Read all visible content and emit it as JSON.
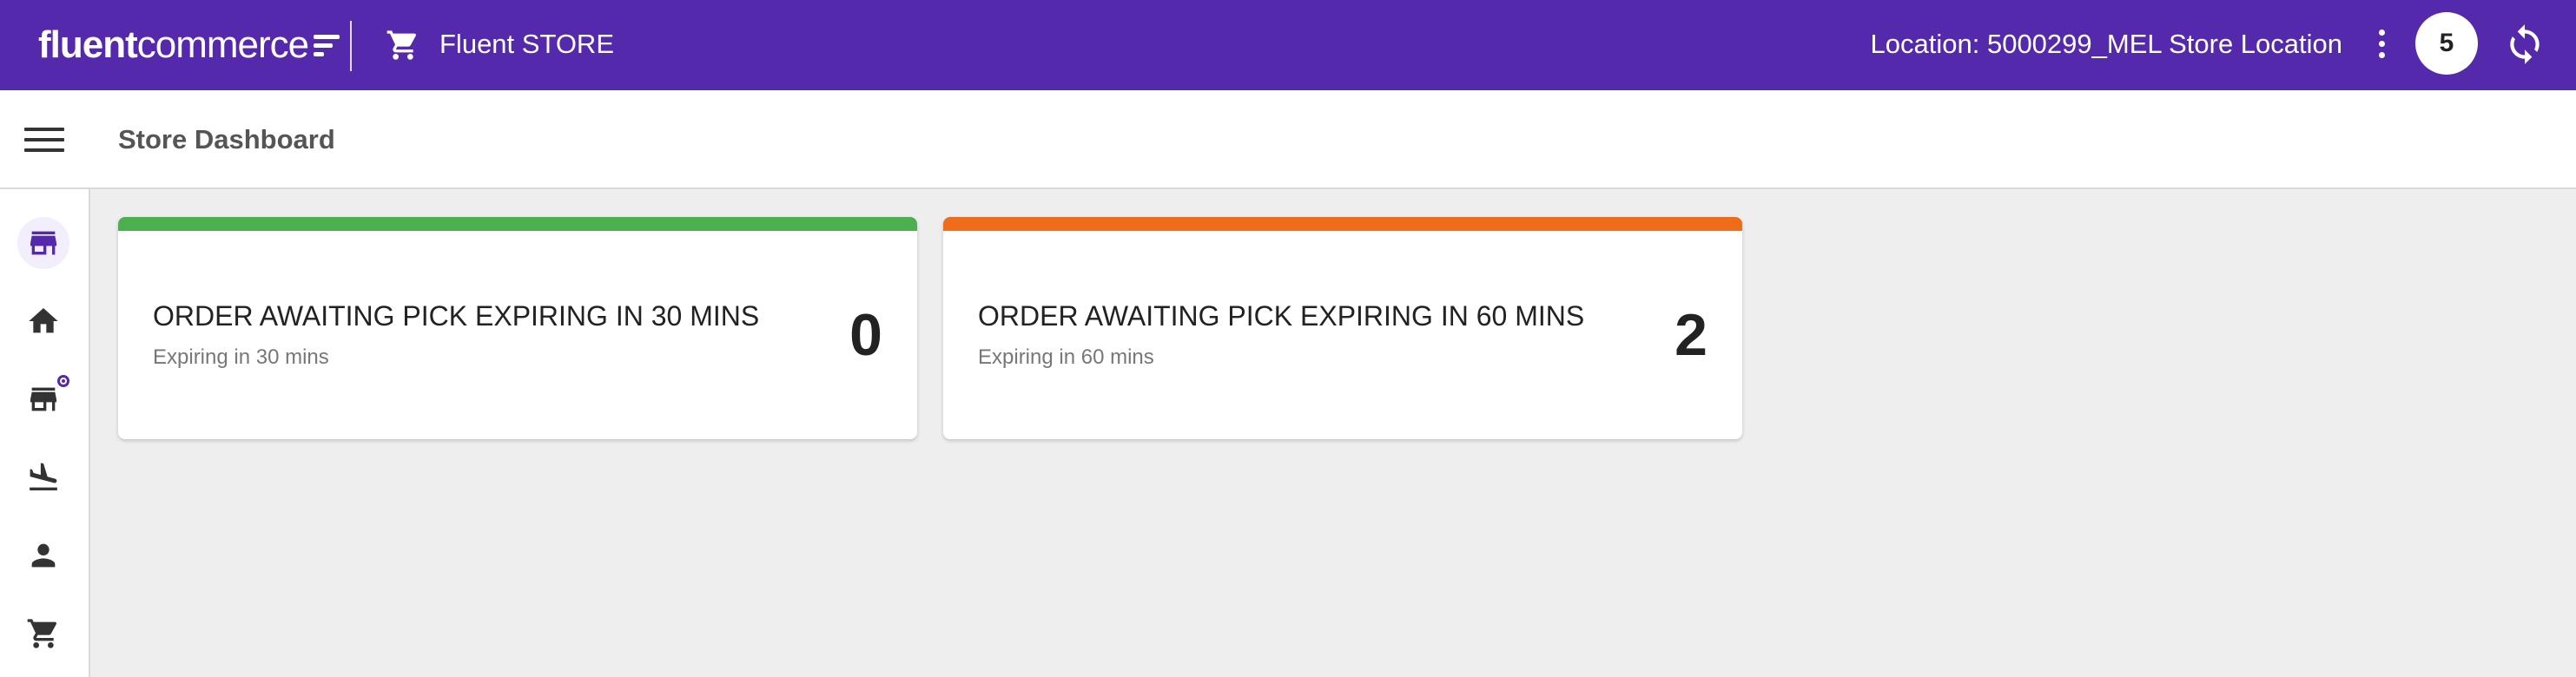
{
  "topbar": {
    "logo_bold": "fluent",
    "logo_light": "commerce",
    "app_title": "Fluent STORE",
    "location": "Location: 5000299_MEL Store Location",
    "avatar_count": "5",
    "background": "#5529ab"
  },
  "page": {
    "title": "Store Dashboard"
  },
  "sidebar": {
    "items": [
      {
        "icon": "store-active-icon",
        "active": true
      },
      {
        "icon": "home-icon",
        "active": false
      },
      {
        "icon": "store-icon",
        "active": false,
        "badge": true
      },
      {
        "icon": "flight-land-icon",
        "active": false
      },
      {
        "icon": "person-icon",
        "active": false
      },
      {
        "icon": "cart-icon",
        "active": false
      }
    ]
  },
  "cards": [
    {
      "title": "ORDER AWAITING PICK EXPIRING IN 30 MINS",
      "subtitle": "Expiring in 30 mins",
      "count": "0",
      "color": "#4caf50"
    },
    {
      "title": "ORDER AWAITING PICK EXPIRING IN 60 MINS",
      "subtitle": "Expiring in 60 mins",
      "count": "2",
      "color": "#ef6c1a"
    }
  ]
}
